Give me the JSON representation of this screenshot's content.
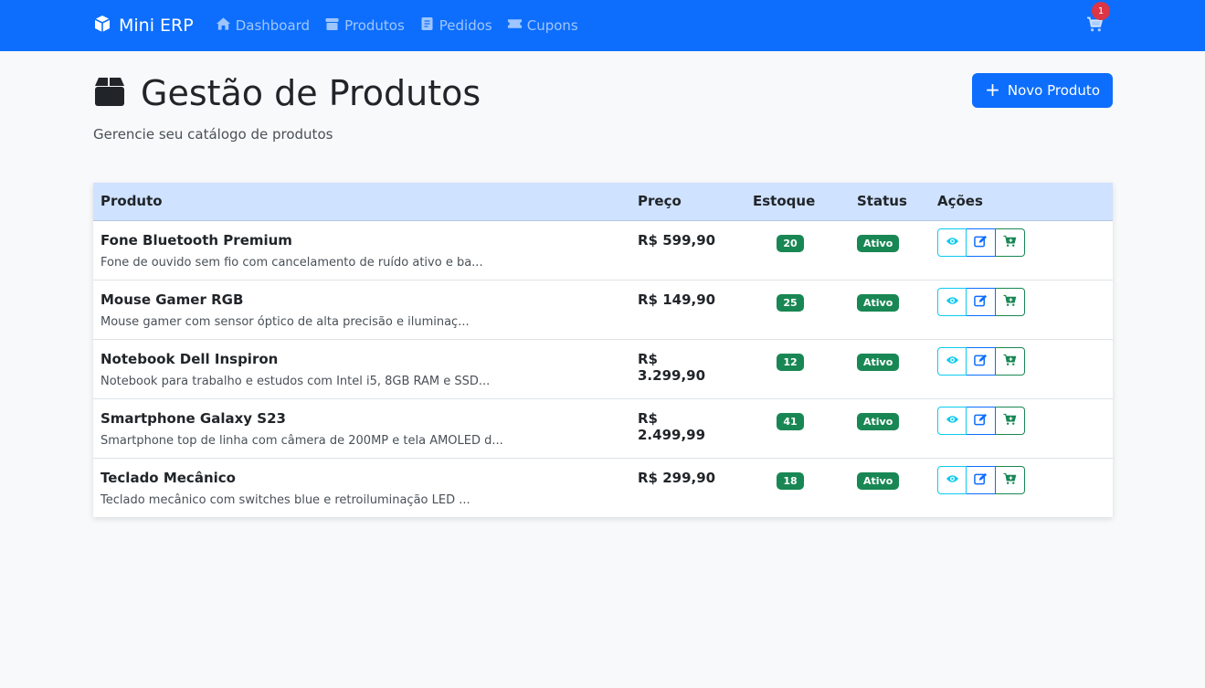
{
  "navbar": {
    "brand": "Mini ERP",
    "links": [
      {
        "label": "Dashboard",
        "icon": "home-icon"
      },
      {
        "label": "Produtos",
        "icon": "box-icon"
      },
      {
        "label": "Pedidos",
        "icon": "document-icon"
      },
      {
        "label": "Cupons",
        "icon": "ticket-icon"
      }
    ],
    "cart_count": "1"
  },
  "header": {
    "title": "Gestão de Produtos",
    "subtitle": "Gerencie seu catálogo de produtos",
    "new_button": "Novo Produto"
  },
  "table": {
    "columns": [
      "Produto",
      "Preço",
      "Estoque",
      "Status",
      "Ações"
    ],
    "rows": [
      {
        "name": "Fone Bluetooth Premium",
        "desc": "Fone de ouvido sem fio com cancelamento de ruído ativo e ba...",
        "price": "R$ 599,90",
        "stock": "20",
        "status": "Ativo"
      },
      {
        "name": "Mouse Gamer RGB",
        "desc": "Mouse gamer com sensor óptico de alta precisão e iluminaç...",
        "price": "R$ 149,90",
        "stock": "25",
        "status": "Ativo"
      },
      {
        "name": "Notebook Dell Inspiron",
        "desc": "Notebook para trabalho e estudos com Intel i5, 8GB RAM e SSD...",
        "price": "R$ 3.299,90",
        "stock": "12",
        "status": "Ativo"
      },
      {
        "name": "Smartphone Galaxy S23",
        "desc": "Smartphone top de linha com câmera de 200MP e tela AMOLED d...",
        "price": "R$ 2.499,99",
        "stock": "41",
        "status": "Ativo"
      },
      {
        "name": "Teclado Mecânico",
        "desc": "Teclado mecânico com switches blue e retroiluminação LED ...",
        "price": "R$ 299,90",
        "stock": "18",
        "status": "Ativo"
      }
    ]
  },
  "colors": {
    "primary": "#0d6efd",
    "success": "#198754",
    "info": "#0dcaf0",
    "danger": "#dc3545",
    "table_header": "#cfe2ff"
  }
}
